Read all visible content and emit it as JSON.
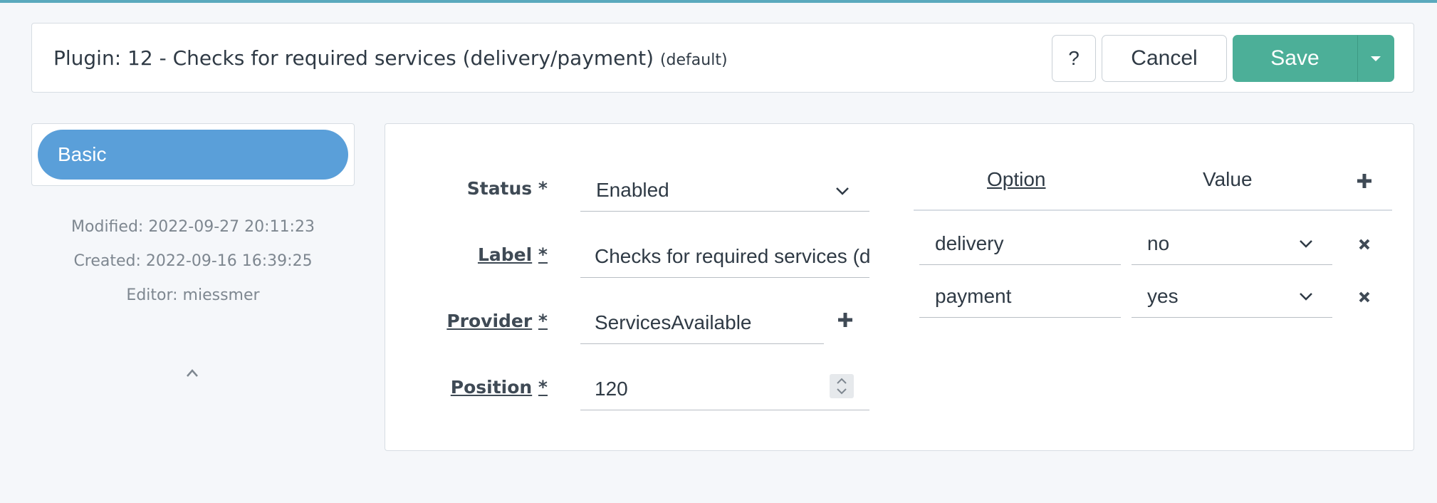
{
  "header": {
    "title": "Plugin: 12 - Checks for required services (delivery/payment)",
    "title_suffix": "(default)",
    "help_label": "?",
    "cancel_label": "Cancel",
    "save_label": "Save"
  },
  "sidebar": {
    "active_tab": "Basic",
    "modified": "Modified: 2022-09-27 20:11:23",
    "created": "Created: 2022-09-16 16:39:25",
    "editor": "Editor: miessmer"
  },
  "form": {
    "status_label": "Status",
    "status_value": "Enabled",
    "label_label": "Label",
    "label_value": "Checks for required services (delivery/payment)",
    "provider_label": "Provider",
    "provider_value": "ServicesAvailable",
    "position_label": "Position",
    "position_value": "120",
    "required_marker": "*"
  },
  "options_table": {
    "col_option": "Option",
    "col_value": "Value",
    "rows": [
      {
        "option": "delivery",
        "value": "no"
      },
      {
        "option": "payment",
        "value": "yes"
      }
    ]
  },
  "colors": {
    "accent_save": "#4caf98",
    "active_tab": "#5a9fd9",
    "top_line": "#5aa9bd"
  },
  "icons": [
    "help-icon",
    "caret-down-icon",
    "chevron-down-icon",
    "plus-icon",
    "close-icon",
    "chevron-up-icon",
    "stepper-icon"
  ]
}
